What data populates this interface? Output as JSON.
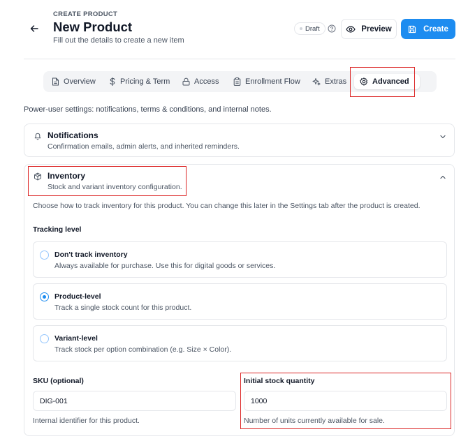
{
  "header": {
    "eyebrow": "CREATE PRODUCT",
    "title": "New Product",
    "subtitle": "Fill out the details to create a new item",
    "status_badge": "Draft",
    "preview_label": "Preview",
    "create_label": "Create"
  },
  "tabs": [
    {
      "label": "Overview",
      "icon": "document-icon"
    },
    {
      "label": "Pricing & Term",
      "icon": "dollar-icon"
    },
    {
      "label": "Access",
      "icon": "lock-icon"
    },
    {
      "label": "Enrollment Flow",
      "icon": "clipboard-icon"
    },
    {
      "label": "Extras",
      "icon": "sparkles-icon"
    },
    {
      "label": "Advanced",
      "icon": "gear-icon",
      "active": true
    }
  ],
  "intro": "Power-user settings: notifications, terms & conditions, and internal notes.",
  "notifications": {
    "title": "Notifications",
    "description": "Confirmation emails, admin alerts, and inherited reminders."
  },
  "inventory": {
    "title": "Inventory",
    "description": "Stock and variant inventory configuration.",
    "body": "Choose how to track inventory for this product. You can change this later in the Settings tab after the product is created.",
    "tracking_label": "Tracking level",
    "options": [
      {
        "title": "Don't track inventory",
        "description": "Always available for purchase. Use this for digital goods or services.",
        "selected": false
      },
      {
        "title": "Product-level",
        "description": "Track a single stock count for this product.",
        "selected": true
      },
      {
        "title": "Variant-level",
        "description": "Track stock per option combination (e.g. Size × Color).",
        "selected": false
      }
    ],
    "sku": {
      "label": "SKU (optional)",
      "value": "DIG-001",
      "help": "Internal identifier for this product."
    },
    "stock": {
      "label": "Initial stock quantity",
      "value": "1000",
      "help": "Number of units currently available for sale."
    }
  },
  "colors": {
    "accent": "#1d8cf0",
    "highlight": "#dc2626",
    "border": "#e5e7eb"
  }
}
